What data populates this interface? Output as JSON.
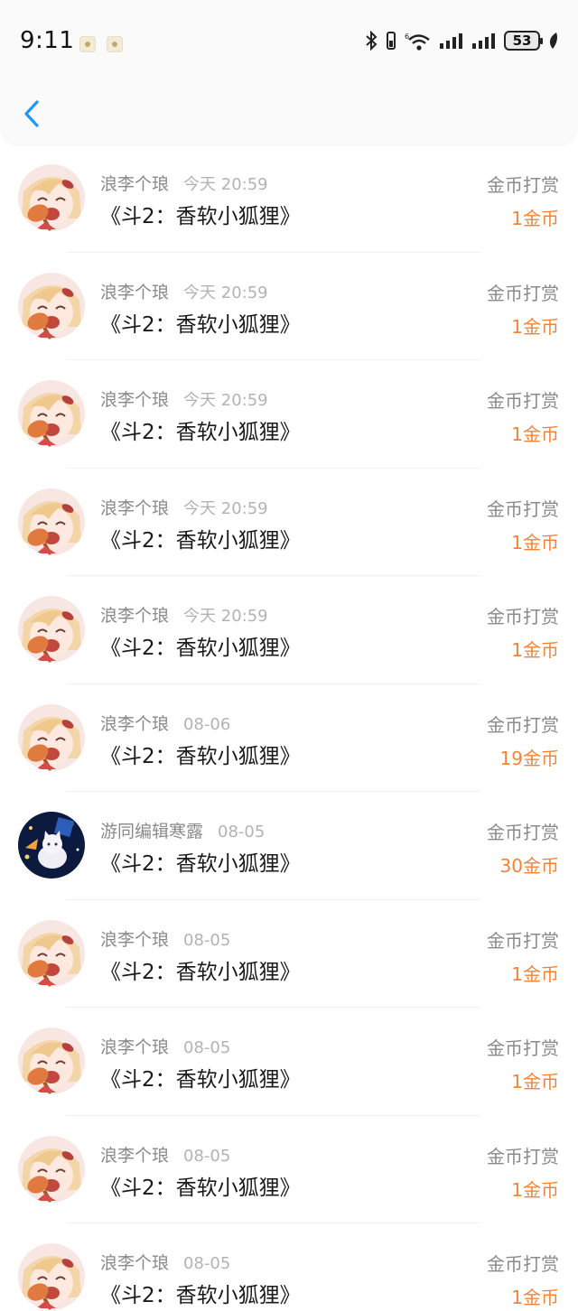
{
  "status_bar": {
    "time": "9:11",
    "battery": "53"
  },
  "header": {
    "back_icon": "chevron-left-icon"
  },
  "records": [
    {
      "user": "浪李个琅",
      "date": "今天 20:59",
      "book": "《斗2：香软小狐狸》",
      "type": "金币打赏",
      "amount": "1金币",
      "avatar": "anime-girl"
    },
    {
      "user": "浪李个琅",
      "date": "今天 20:59",
      "book": "《斗2：香软小狐狸》",
      "type": "金币打赏",
      "amount": "1金币",
      "avatar": "anime-girl"
    },
    {
      "user": "浪李个琅",
      "date": "今天 20:59",
      "book": "《斗2：香软小狐狸》",
      "type": "金币打赏",
      "amount": "1金币",
      "avatar": "anime-girl"
    },
    {
      "user": "浪李个琅",
      "date": "今天 20:59",
      "book": "《斗2：香软小狐狸》",
      "type": "金币打赏",
      "amount": "1金币",
      "avatar": "anime-girl"
    },
    {
      "user": "浪李个琅",
      "date": "今天 20:59",
      "book": "《斗2：香软小狐狸》",
      "type": "金币打赏",
      "amount": "1金币",
      "avatar": "anime-girl"
    },
    {
      "user": "浪李个琅",
      "date": "08-06",
      "book": "《斗2：香软小狐狸》",
      "type": "金币打赏",
      "amount": "19金币",
      "avatar": "anime-girl"
    },
    {
      "user": "游同编辑寒露",
      "date": "08-05",
      "book": "《斗2：香软小狐狸》",
      "type": "金币打赏",
      "amount": "30金币",
      "avatar": "night-cat"
    },
    {
      "user": "浪李个琅",
      "date": "08-05",
      "book": "《斗2：香软小狐狸》",
      "type": "金币打赏",
      "amount": "1金币",
      "avatar": "anime-girl"
    },
    {
      "user": "浪李个琅",
      "date": "08-05",
      "book": "《斗2：香软小狐狸》",
      "type": "金币打赏",
      "amount": "1金币",
      "avatar": "anime-girl"
    },
    {
      "user": "浪李个琅",
      "date": "08-05",
      "book": "《斗2：香软小狐狸》",
      "type": "金币打赏",
      "amount": "1金币",
      "avatar": "anime-girl"
    },
    {
      "user": "浪李个琅",
      "date": "08-05",
      "book": "《斗2：香软小狐狸》",
      "type": "金币打赏",
      "amount": "1金币",
      "avatar": "anime-girl"
    }
  ],
  "colors": {
    "accent": "#2196F3",
    "amount": "#F0843A"
  }
}
